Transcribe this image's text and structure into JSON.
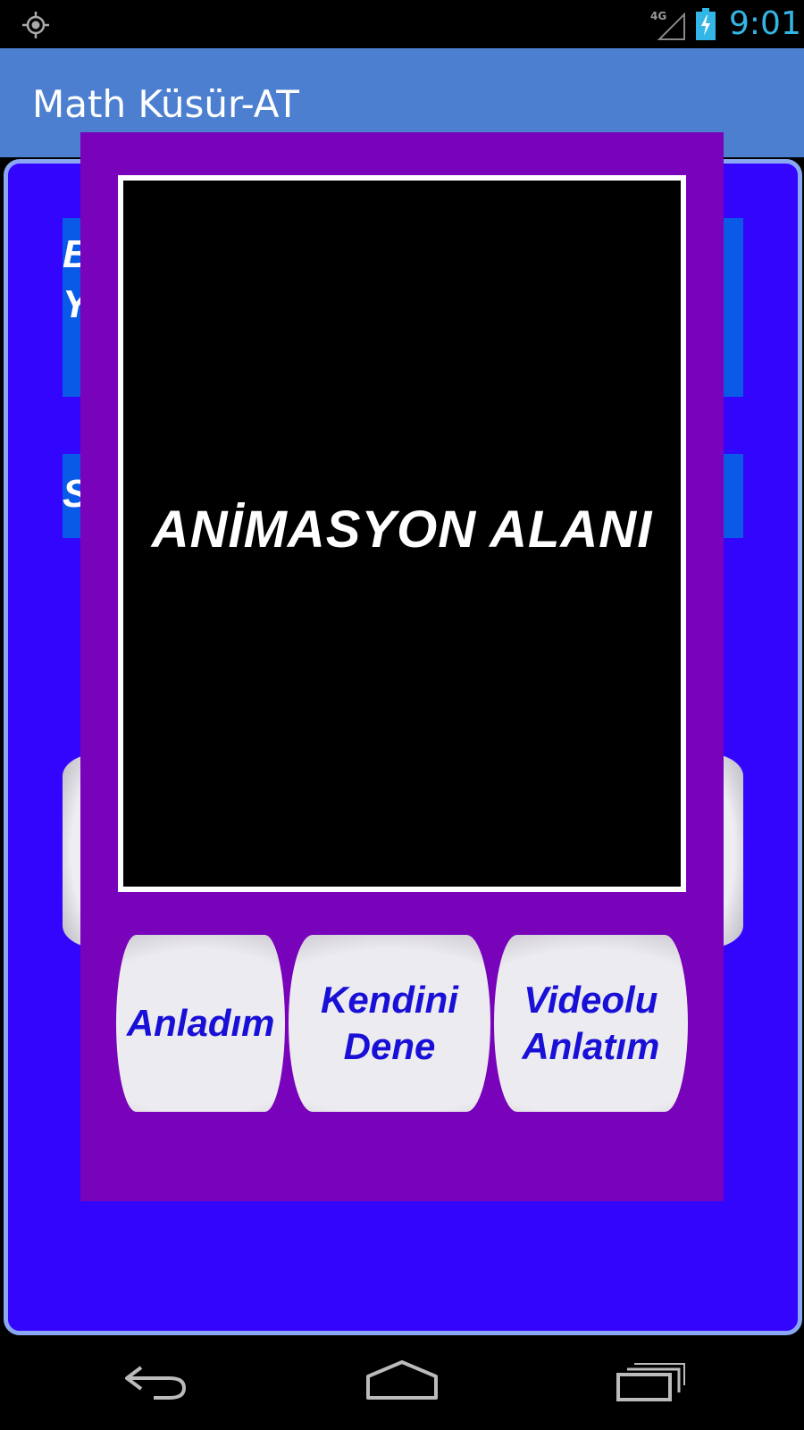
{
  "status_bar": {
    "network": "4G",
    "time": "9:01",
    "icons": [
      "gps-icon",
      "signal-icon",
      "battery-charging-icon"
    ]
  },
  "action_bar": {
    "title": "Math Küsür-AT"
  },
  "background": {
    "block1_lines": [
      "B",
      "Y"
    ],
    "block2_text": "S"
  },
  "dialog": {
    "animation_label": "ANİMASYON ALANI",
    "buttons": {
      "understood": "Anladım",
      "try_yourself": "Kendini Dene",
      "video_lesson": "Videolu Anlatım"
    }
  },
  "nav_bar": {
    "icons": [
      "back-icon",
      "home-icon",
      "recent-apps-icon"
    ]
  },
  "colors": {
    "status_bar": "#000000",
    "action_bar": "#4c7fd0",
    "main_panel": "#3305fd",
    "bg_block": "#0a5ae8",
    "dialog": "#7803bb",
    "button_text": "#1810d6",
    "clock": "#33b5e5"
  }
}
